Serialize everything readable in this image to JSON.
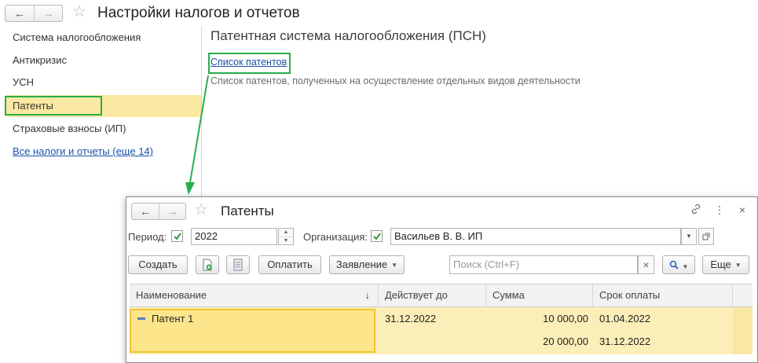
{
  "window": {
    "back_icon": "←",
    "forward_icon": "→",
    "favorite_icon": "☆",
    "title": "Настройки налогов и отчетов"
  },
  "sidebar": {
    "items": [
      {
        "label": "Система налогообложения"
      },
      {
        "label": "Антикризис"
      },
      {
        "label": "УСН"
      },
      {
        "label": "Патенты"
      },
      {
        "label": "Страховые взносы (ИП)"
      }
    ],
    "all_link": "Все налоги и отчеты (еще 14)"
  },
  "content": {
    "title": "Патентная система налогообложения (ПСН)",
    "link": "Список патентов",
    "description": "Список патентов, полученных на осуществление отдельных видов деятельности"
  },
  "popup": {
    "back_icon": "←",
    "forward_icon": "→",
    "favorite_icon": "☆",
    "title": "Патенты",
    "link_icon": "🔗",
    "more_icon": "⋮",
    "close_icon": "×",
    "filters": {
      "period_label": "Период:",
      "period_value": "2022",
      "org_label": "Организация:",
      "org_value": "Васильев В. В. ИП"
    },
    "toolbar": {
      "create": "Создать",
      "pay": "Оплатить",
      "application": "Заявление",
      "search_placeholder": "Поиск (Ctrl+F)",
      "clear_icon": "×",
      "search_icon": "🔍",
      "more": "Еще"
    },
    "table": {
      "columns": [
        "Наименование",
        "Действует до",
        "Сумма",
        "Срок оплаты"
      ],
      "sort_icon": "↓",
      "rows": [
        {
          "name": "Патент 1",
          "valid_until": "31.12.2022",
          "amount": "10 000,00",
          "due": "01.04.2022"
        },
        {
          "name": "",
          "valid_until": "",
          "amount": "20 000,00",
          "due": "31.12.2022"
        }
      ]
    }
  },
  "colors": {
    "highlight_green": "#27ae4a",
    "active_row": "#fbe8a3",
    "link_blue": "#1c50a8"
  }
}
